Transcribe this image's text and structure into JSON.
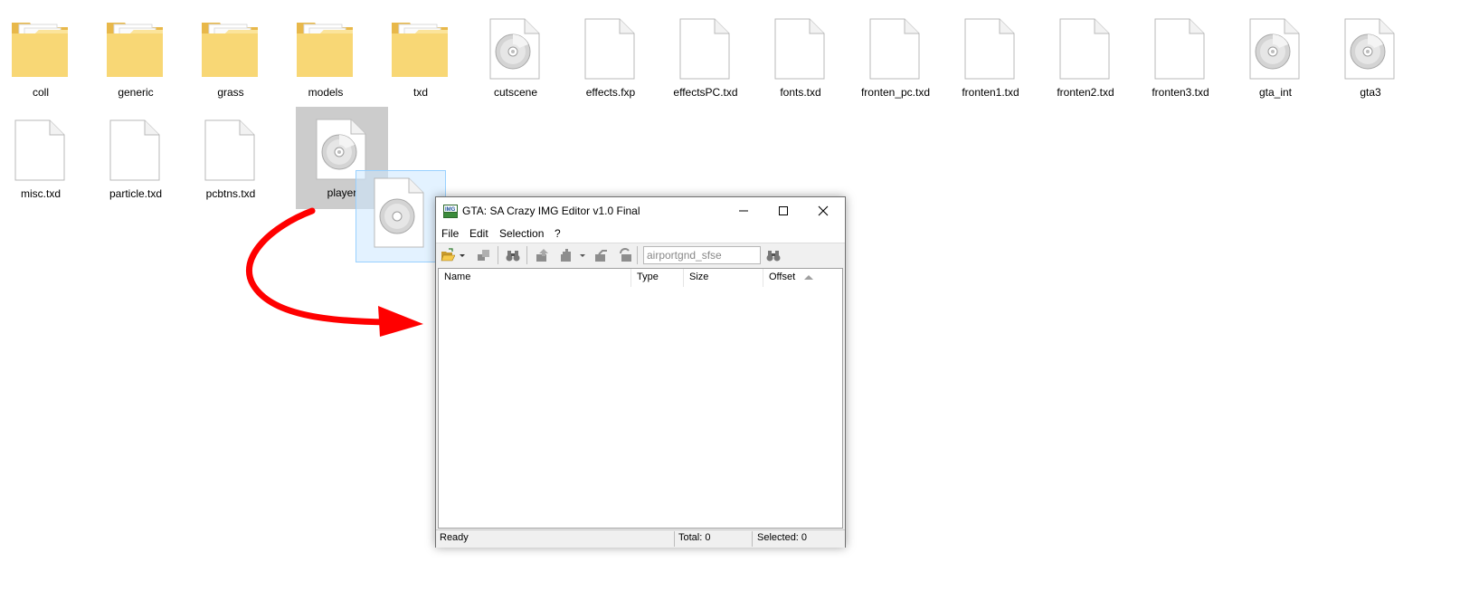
{
  "desktop": {
    "row1": [
      {
        "label": "coll",
        "kind": "folder"
      },
      {
        "label": "generic",
        "kind": "folder"
      },
      {
        "label": "grass",
        "kind": "folder"
      },
      {
        "label": "models",
        "kind": "folder"
      },
      {
        "label": "txd",
        "kind": "folder"
      },
      {
        "label": "cutscene",
        "kind": "disc"
      },
      {
        "label": "effects.fxp",
        "kind": "file"
      },
      {
        "label": "effectsPC.txd",
        "kind": "file"
      },
      {
        "label": "fonts.txd",
        "kind": "file"
      },
      {
        "label": "fronten_pc.txd",
        "kind": "file"
      },
      {
        "label": "fronten1.txd",
        "kind": "file"
      },
      {
        "label": "fronten2.txd",
        "kind": "file"
      },
      {
        "label": "fronten3.txd",
        "kind": "file"
      },
      {
        "label": "gta_int",
        "kind": "disc"
      },
      {
        "label": "gta3",
        "kind": "disc"
      }
    ],
    "row2": [
      {
        "label": "misc.txd",
        "kind": "file"
      },
      {
        "label": "particle.txd",
        "kind": "file"
      },
      {
        "label": "pcbtns.txd",
        "kind": "file"
      },
      {
        "label": "player",
        "kind": "disc",
        "selected": true
      }
    ]
  },
  "window": {
    "title": "GTA: SA Crazy IMG Editor v1.0 Final",
    "menu": [
      "File",
      "Edit",
      "Selection",
      "?"
    ],
    "search": {
      "value": "airportgnd_sfse"
    },
    "columns": [
      "Name",
      "Type",
      "Size",
      "Offset"
    ],
    "status": {
      "ready": "Ready",
      "total": "Total: 0",
      "selected": "Selected: 0"
    }
  },
  "colors": {
    "arrow": "#ff0000",
    "folder": "#f8d775",
    "selection": "#cccccc",
    "drag_ghost": "#cce8ff"
  }
}
